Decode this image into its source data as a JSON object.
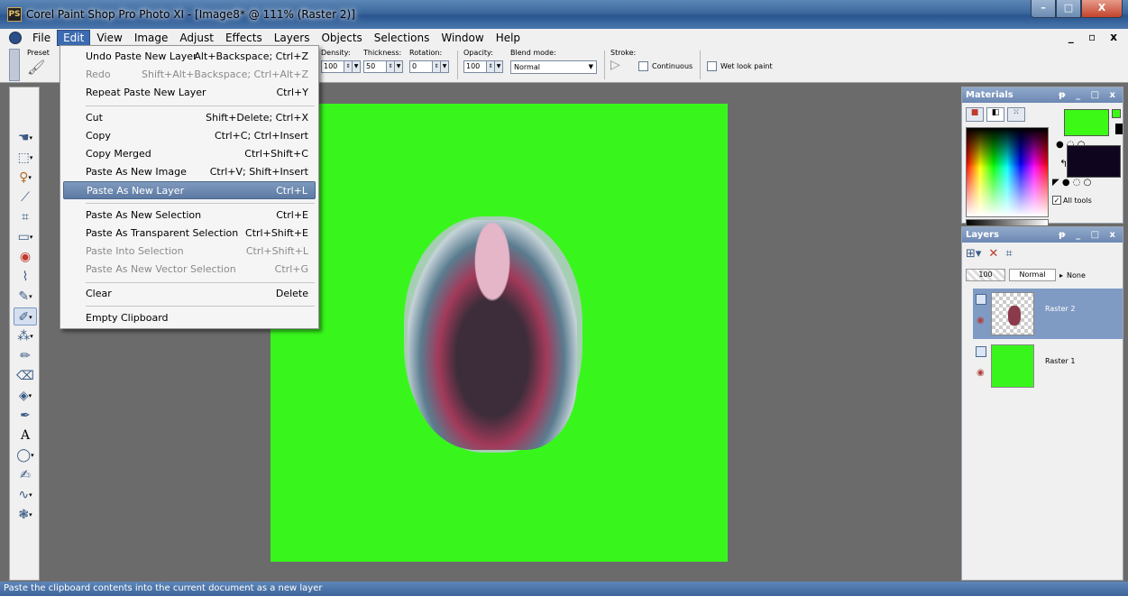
{
  "window": {
    "title": "Corel Paint Shop Pro Photo XI - [Image8* @ 111% (Raster 2)]",
    "app_icon": "PS",
    "controls": {
      "minimize": "–",
      "maximize": "□",
      "close": "X"
    }
  },
  "menubar": {
    "items": [
      "File",
      "Edit",
      "View",
      "Image",
      "Adjust",
      "Effects",
      "Layers",
      "Objects",
      "Selections",
      "Window",
      "Help"
    ],
    "active": "Edit",
    "mdi_controls": "_ ▫ x"
  },
  "tool_options": {
    "presets_label": "Preset",
    "density": {
      "label": "Density:",
      "value": "100"
    },
    "thickness": {
      "label": "Thickness:",
      "value": "50"
    },
    "rotation": {
      "label": "Rotation:",
      "value": "0"
    },
    "opacity": {
      "label": "Opacity:",
      "value": "100"
    },
    "blend_mode": {
      "label": "Blend mode:",
      "value": "Normal"
    },
    "stroke": {
      "label": "Stroke:"
    },
    "continuous_label": "Continuous",
    "wet_look_label": "Wet look paint"
  },
  "edit_menu": {
    "items": [
      {
        "label": "Undo Paste New Layer",
        "shortcut": "Alt+Backspace; Ctrl+Z",
        "enabled": true
      },
      {
        "label": "Redo",
        "shortcut": "Shift+Alt+Backspace; Ctrl+Alt+Z",
        "enabled": false
      },
      {
        "label": "Repeat Paste New Layer",
        "shortcut": "Ctrl+Y",
        "enabled": true
      },
      {
        "label": "Cut",
        "shortcut": "Shift+Delete; Ctrl+X",
        "enabled": true
      },
      {
        "label": "Copy",
        "shortcut": "Ctrl+C; Ctrl+Insert",
        "enabled": true
      },
      {
        "label": "Copy Merged",
        "shortcut": "Ctrl+Shift+C",
        "enabled": true
      },
      {
        "label": "Paste As New Image",
        "shortcut": "Ctrl+V; Shift+Insert",
        "enabled": true
      },
      {
        "label": "Paste As New Layer",
        "shortcut": "Ctrl+L",
        "enabled": true,
        "highlighted": true
      },
      {
        "label": "Paste As New Selection",
        "shortcut": "Ctrl+E",
        "enabled": true
      },
      {
        "label": "Paste As Transparent Selection",
        "shortcut": "Ctrl+Shift+E",
        "enabled": true
      },
      {
        "label": "Paste Into Selection",
        "shortcut": "Ctrl+Shift+L",
        "enabled": false
      },
      {
        "label": "Paste As New Vector Selection",
        "shortcut": "Ctrl+G",
        "enabled": false
      },
      {
        "label": "Clear",
        "shortcut": "Delete",
        "enabled": true
      },
      {
        "label": "Empty Clipboard",
        "shortcut": "",
        "enabled": true
      }
    ]
  },
  "tools": [
    "pan-icon",
    "pick-icon",
    "lasso-icon",
    "dropper-icon",
    "crop-icon",
    "move-icon",
    "red-eye-icon",
    "clone-icon",
    "makeover-icon",
    "brush-icon",
    "airbrush-icon",
    "retouch-icon",
    "eraser-icon",
    "fill-icon",
    "pen-icon",
    "text-icon",
    "shape-icon",
    "pencil-icon",
    "warp-icon",
    "picture-tube-icon"
  ],
  "materials": {
    "title": "Materials",
    "panel_controls": "ᵽ _ □ x",
    "foreground_color": "#3dfa16",
    "background_color": "#10051e",
    "all_tools_label": "All tools",
    "all_tools_checked": true
  },
  "layers": {
    "title": "Layers",
    "panel_controls": "ᵽ _ □ x",
    "opacity": "100",
    "blend_mode": "Normal",
    "mask_label": "None",
    "items": [
      {
        "name": "Raster 2",
        "selected": true
      },
      {
        "name": "Raster 1",
        "selected": false
      }
    ]
  },
  "canvas": {
    "fill_color": "#38f61c"
  },
  "status": {
    "text": "Paste the clipboard contents into the current document as a new layer"
  }
}
